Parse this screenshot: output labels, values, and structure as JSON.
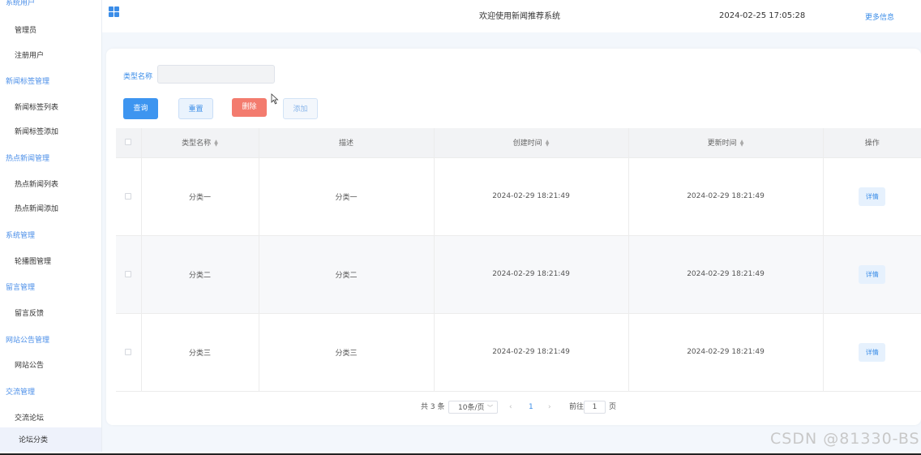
{
  "sidebar": {
    "top_clipped_label": "系统用户",
    "groups": [
      {
        "label": "系统用户",
        "items": [
          "管理员",
          "注册用户"
        ]
      },
      {
        "label": "新闻标签管理",
        "items": [
          "新闻标签列表",
          "新闻标签添加"
        ]
      },
      {
        "label": "热点新闻管理",
        "items": [
          "热点新闻列表",
          "热点新闻添加"
        ]
      },
      {
        "label": "系统管理",
        "items": [
          "轮播图管理"
        ]
      },
      {
        "label": "留言管理",
        "items": [
          "留言反馈"
        ]
      },
      {
        "label": "网站公告管理",
        "items": [
          "网站公告"
        ]
      },
      {
        "label": "交流管理",
        "items": [
          "交流论坛",
          "论坛分类"
        ]
      }
    ],
    "active_item": "论坛分类"
  },
  "header": {
    "title": "欢迎使用新闻推荐系统",
    "datetime": "2024-02-25 17:05:28",
    "more_link": "更多信息",
    "menu_icon": "grid-icon"
  },
  "search": {
    "label": "类型名称",
    "value": "",
    "placeholder": ""
  },
  "actions": {
    "query": "查询",
    "reset": "重置",
    "delete": "删除",
    "add": "添加"
  },
  "table": {
    "columns": [
      "类型名称",
      "描述",
      "创建时间",
      "更新时间",
      "操作"
    ],
    "rows": [
      {
        "name": "分类一",
        "desc": "分类一",
        "created": "2024-02-29 18:21:49",
        "updated": "2024-02-29 18:21:49",
        "action": "详情"
      },
      {
        "name": "分类二",
        "desc": "分类二",
        "created": "2024-02-29 18:21:49",
        "updated": "2024-02-29 18:21:49",
        "action": "详情"
      },
      {
        "name": "分类三",
        "desc": "分类三",
        "created": "2024-02-29 18:21:49",
        "updated": "2024-02-29 18:21:49",
        "action": "详情"
      }
    ]
  },
  "pagination": {
    "total": "共 3 条",
    "page_size": "10条/页",
    "current_page": "1",
    "goto_label": "前往",
    "goto_value": "1",
    "page_suffix": "页",
    "prev_icon": "chevron-left-icon",
    "next_icon": "chevron-right-icon"
  },
  "watermark": "CSDN @81330-BS",
  "colors": {
    "accent": "#3d95f0",
    "danger": "#f37b6e",
    "sidebar_group": "#4a8ee8",
    "content_bg": "#f3f7fc"
  }
}
